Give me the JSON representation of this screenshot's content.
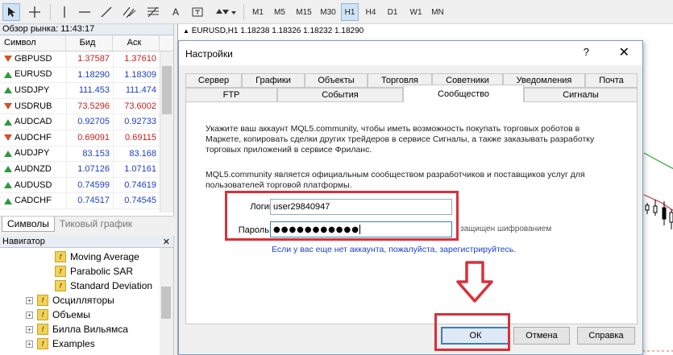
{
  "toolbar": {
    "timeframes": [
      "M1",
      "M5",
      "M15",
      "M30",
      "H1",
      "H4",
      "D1",
      "W1",
      "MN"
    ],
    "active_timeframe": "H1",
    "text_tool": "A"
  },
  "market_watch": {
    "title": "Обзор рынка: 11:43:17",
    "col_symbol": "Символ",
    "col_bid": "Бид",
    "col_ask": "Аск",
    "rows": [
      {
        "symbol": "GBPUSD",
        "bid": "1.37587",
        "ask": "1.37610",
        "dir": "down"
      },
      {
        "symbol": "EURUSD",
        "bid": "1.18290",
        "ask": "1.18309",
        "dir": "up"
      },
      {
        "symbol": "USDJPY",
        "bid": "111.453",
        "ask": "111.474",
        "dir": "up"
      },
      {
        "symbol": "USDRUB",
        "bid": "73.5296",
        "ask": "73.6002",
        "dir": "down"
      },
      {
        "symbol": "AUDCAD",
        "bid": "0.92705",
        "ask": "0.92733",
        "dir": "up"
      },
      {
        "symbol": "AUDCHF",
        "bid": "0.69091",
        "ask": "0.69115",
        "dir": "down"
      },
      {
        "symbol": "AUDJPY",
        "bid": "83.153",
        "ask": "83.168",
        "dir": "up"
      },
      {
        "symbol": "AUDNZD",
        "bid": "1.07126",
        "ask": "1.07161",
        "dir": "up"
      },
      {
        "symbol": "AUDUSD",
        "bid": "0.74599",
        "ask": "0.74619",
        "dir": "up"
      },
      {
        "symbol": "CADCHF",
        "bid": "0.74517",
        "ask": "0.74545",
        "dir": "up"
      }
    ],
    "tabs": [
      "Символы",
      "Тиковый график"
    ]
  },
  "navigator": {
    "title": "Навигатор",
    "items": [
      {
        "label": "Moving Average",
        "type": "indicator"
      },
      {
        "label": "Parabolic SAR",
        "type": "indicator"
      },
      {
        "label": "Standard Deviation",
        "type": "indicator"
      },
      {
        "label": "Осцилляторы",
        "type": "folder"
      },
      {
        "label": "Объемы",
        "type": "folder"
      },
      {
        "label": "Билла Вильямса",
        "type": "folder"
      },
      {
        "label": "Examples",
        "type": "folder"
      }
    ]
  },
  "chart": {
    "header": "EURUSD,H1  1.18238 1.18326 1.18232 1.18290"
  },
  "dialog": {
    "title": "Настройки",
    "help": "?",
    "close": "✕",
    "tabs_row1": [
      "Сервер",
      "Графики",
      "Объекты",
      "Торговля",
      "Советники",
      "Уведомления",
      "Почта"
    ],
    "tabs_row2": [
      "FTP",
      "События",
      "Сообщество",
      "Сигналы"
    ],
    "active_tab": "Сообщество",
    "intro": "Укажите ваш аккаунт MQL5.community, чтобы иметь возможность покупать торговых роботов в Маркете, копировать сделки других трейдеров в сервисе Сигналы, а также заказывать разработку торговых приложений в сервисе Фриланс.",
    "about": "MQL5.community является официальным сообществом разработчиков и поставщиков услуг для пользователей торговой платформы.",
    "login_label": "Логин:",
    "login_value": "user29840947",
    "password_label": "Пароль:",
    "password_value": "●●●●●●●●●●●",
    "encrypted_note": "защищен шифрованием",
    "register_link": "Если у вас еще нет аккаунта, пожалуйста, зарегистрируйтесь.",
    "ok": "ОК",
    "cancel": "Отмена",
    "help_btn": "Справка"
  },
  "colors": {
    "annotation_red": "#d8303a",
    "link_blue": "#1a3fd0",
    "bid_red": "#c81e1e",
    "bid_blue": "#1e3fbe"
  }
}
